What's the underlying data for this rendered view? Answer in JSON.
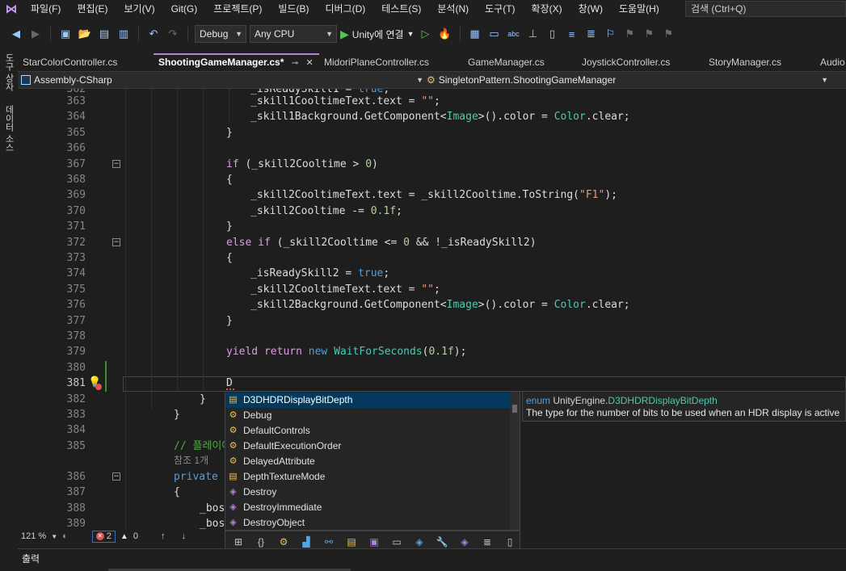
{
  "menu": {
    "items": [
      "파일(F)",
      "편집(E)",
      "보기(V)",
      "Git(G)",
      "프로젝트(P)",
      "빌드(B)",
      "디버그(D)",
      "테스트(S)",
      "분석(N)",
      "도구(T)",
      "확장(X)",
      "창(W)",
      "도움말(H)"
    ],
    "search_label": "검색 (Ctrl+Q)"
  },
  "toolbar": {
    "config": "Debug",
    "platform": "Any CPU",
    "run_label": "Unity에 연결"
  },
  "left_strip": {
    "toolbox": "도구 상자",
    "data_sources": "데이터 소스"
  },
  "tabs": [
    {
      "label": "StarColorController.cs",
      "active": false
    },
    {
      "label": "ShootingGameManager.cs*",
      "active": true
    },
    {
      "label": "MidoriPlaneController.cs",
      "active": false
    },
    {
      "label": "GameManager.cs",
      "active": false
    },
    {
      "label": "JoystickController.cs",
      "active": false
    },
    {
      "label": "StoryManager.cs",
      "active": false
    },
    {
      "label": "Audio",
      "active": false
    }
  ],
  "navbar": {
    "project": "Assembly-CSharp",
    "type": "SingletonPattern.ShootingGameManager"
  },
  "editor": {
    "line_numbers": [
      "362",
      "363",
      "364",
      "365",
      "366",
      "367",
      "368",
      "369",
      "370",
      "371",
      "372",
      "373",
      "374",
      "375",
      "376",
      "377",
      "378",
      "379",
      "380",
      "381",
      "382",
      "383",
      "384",
      "385",
      "",
      "386",
      "387",
      "388",
      "389"
    ],
    "current_line": "381",
    "typed_text": "D"
  },
  "completion": {
    "items": [
      {
        "label": "D3DHDRDisplayBitDepth",
        "kind": "enum-icon"
      },
      {
        "label": "Debug",
        "kind": "class-icon"
      },
      {
        "label": "DefaultControls",
        "kind": "class-icon"
      },
      {
        "label": "DefaultExecutionOrder",
        "kind": "class-icon"
      },
      {
        "label": "DelayedAttribute",
        "kind": "class-icon"
      },
      {
        "label": "DepthTextureMode",
        "kind": "enum-icon"
      },
      {
        "label": "Destroy",
        "kind": "method-icon"
      },
      {
        "label": "DestroyImmediate",
        "kind": "method-icon"
      },
      {
        "label": "DestroyObject",
        "kind": "method-icon"
      }
    ],
    "selected_index": 0
  },
  "tooltip": {
    "kind": "enum",
    "namespace": "UnityEngine.",
    "type": "D3DHDRDisplayBitDepth",
    "description": "The type for the number of bits to be used when an HDR display is active"
  },
  "status": {
    "zoom": "121 %",
    "errors": "2",
    "warnings": "0"
  },
  "output": {
    "title": "출력"
  },
  "colors": {
    "accent": "#b180d7",
    "keyword": "#569cd6",
    "string": "#d69d85",
    "type": "#4ec9b0",
    "comment": "#57a64a",
    "error": "#e05252"
  }
}
